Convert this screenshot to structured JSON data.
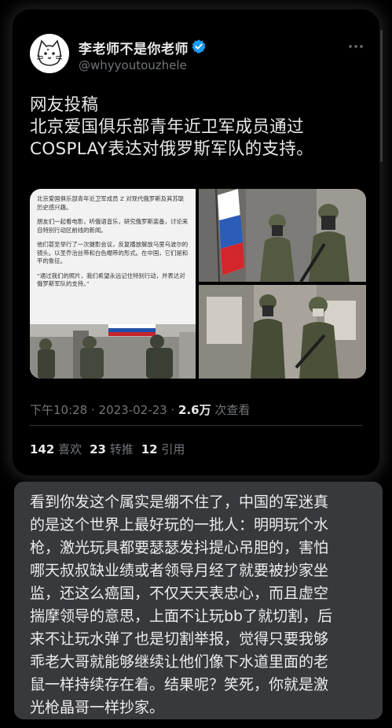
{
  "tweet": {
    "display_name": "李老师不是你老师",
    "handle": "@whyyoutouzhele",
    "text_lines": [
      "网友投稿",
      "北京爱国俱乐部青年近卫军成员通过",
      "COSPLAY表达对俄罗斯军队的支持。"
    ],
    "media": {
      "article_paragraphs": [
        "北京爱国俱乐部青年近卫军成员 Z 对现代俄罗斯及其苏联历史感兴趣。",
        "朋友们一起看电影，听俄语音乐，研究俄罗斯装备，讨论来自特别行动区前线的新闻。",
        "他们甚至举行了一次摄影会议，反复播放解放马里乌波尔的镜头。以圣乔治丝带和白色绷带的形式。在中国，它们是和平的象征。",
        "“通过我们的照片，我们希望永远记住特别行动，并表达对俄罗斯军队的支持。”"
      ]
    },
    "time": "下午10:28",
    "separator": " · ",
    "date": "2023-02-23",
    "views_count": "2.6万",
    "views_label": " 次查看",
    "stats": {
      "likes_count": "142",
      "likes_label": " 喜欢",
      "retweets_count": "23",
      "retweets_label": " 转推",
      "quotes_count": "12",
      "quotes_label": " 引用"
    }
  },
  "reply": {
    "lines": [
      "看到你发这个属实是绷不住了，中国的军迷真",
      "的是这个世界上最好玩的一批人：明明玩个水",
      "枪，激光玩具都要瑟瑟发抖提心吊胆的，害怕",
      "哪天叔叔缺业绩或者领导月经了就要被抄家坐",
      "监，还这么癌国，不仅天天表忠心，而且虚空",
      "揣摩领导的意思，上面不让玩bb了就切割，后",
      "来不让玩水弹了也是切割举报，觉得只要我够",
      "乖老大哥就能够继续让他们像下水道里面的老",
      "鼠一样持续存在着。结果呢？笑死，你就是激",
      "光枪晶哥一样抄家。"
    ]
  },
  "colors": {
    "background": "#000000",
    "primary_text": "#e7e9ea",
    "secondary_text": "#71767b",
    "verified_blue": "#1d9bf0",
    "reply_card": "#37393d"
  },
  "icons": [
    "cat-avatar-icon",
    "verified-badge-icon",
    "more-options-icon"
  ]
}
